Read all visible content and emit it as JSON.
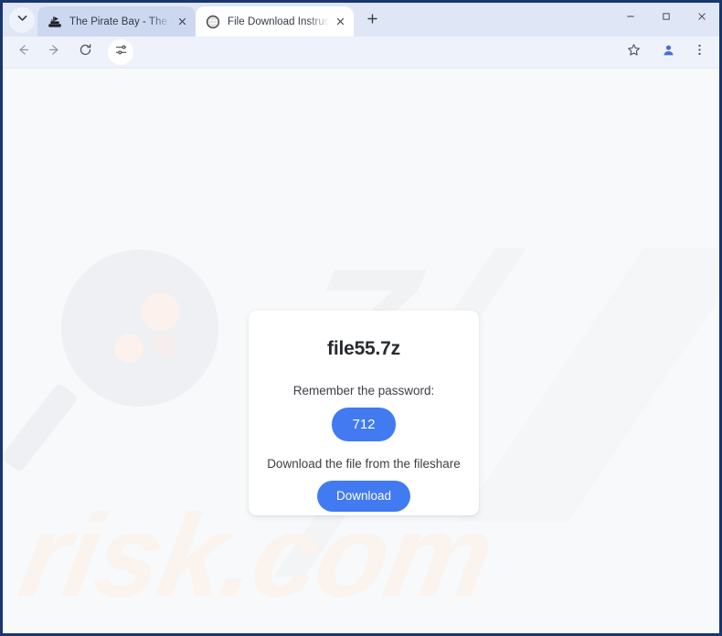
{
  "browser": {
    "tab_search_icon": "chevron-down-icon",
    "new_tab_icon": "plus-icon",
    "tabs": [
      {
        "title": "The Pirate Bay - The galaxy's m",
        "favicon": "pirate-ship-icon",
        "active": false,
        "close_icon": "close-icon"
      },
      {
        "title": "File Download Instructions for",
        "favicon": "globe-icon",
        "active": true,
        "close_icon": "close-icon"
      }
    ],
    "window_controls": {
      "minimize": "minimize-icon",
      "maximize": "maximize-icon",
      "close": "close-icon"
    },
    "toolbar": {
      "back_icon": "back-arrow-icon",
      "forward_icon": "forward-arrow-icon",
      "reload_icon": "reload-icon",
      "tune_icon": "tune-icon",
      "bookmark_icon": "star-icon",
      "profile_icon": "profile-avatar-icon",
      "menu_icon": "three-dot-menu-icon",
      "address_value": "",
      "address_placeholder": ""
    }
  },
  "page": {
    "watermark_logo": "7",
    "watermark_text": "risk.com",
    "background_color": "#f8f9fa",
    "accent_color": "#417af1",
    "card": {
      "title": "file55.7z",
      "password_label": "Remember the password:",
      "password_value": "712",
      "download_label": "Download the file from the fileshare",
      "download_button": "Download"
    }
  }
}
